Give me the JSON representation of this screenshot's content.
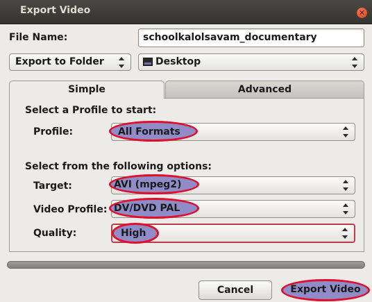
{
  "window": {
    "title": "Export Video",
    "close_icon": "close-icon"
  },
  "file_name": {
    "label": "File Name:",
    "value": "schoolkalolsavam_documentary"
  },
  "export_to": {
    "selected": "Export to Folder"
  },
  "folder": {
    "selected": "Desktop",
    "icon": "folder-icon"
  },
  "tabs": [
    {
      "label": "Simple",
      "active": true
    },
    {
      "label": "Advanced",
      "active": false
    }
  ],
  "simple": {
    "profile_heading": "Select a Profile to start:",
    "profile_label": "Profile:",
    "profile_value": "All Formats",
    "options_heading": "Select from the following options:",
    "target_label": "Target:",
    "target_value": "AVI (mpeg2)",
    "video_profile_label": "Video Profile:",
    "video_profile_value": "DV/DVD PAL",
    "quality_label": "Quality:",
    "quality_value": "High"
  },
  "buttons": {
    "cancel": "Cancel",
    "export": "Export Video"
  },
  "colors": {
    "annotation_red": "#e0102a",
    "highlight_purple": "#8f8cc8",
    "titlebar": "#3c3b37"
  }
}
